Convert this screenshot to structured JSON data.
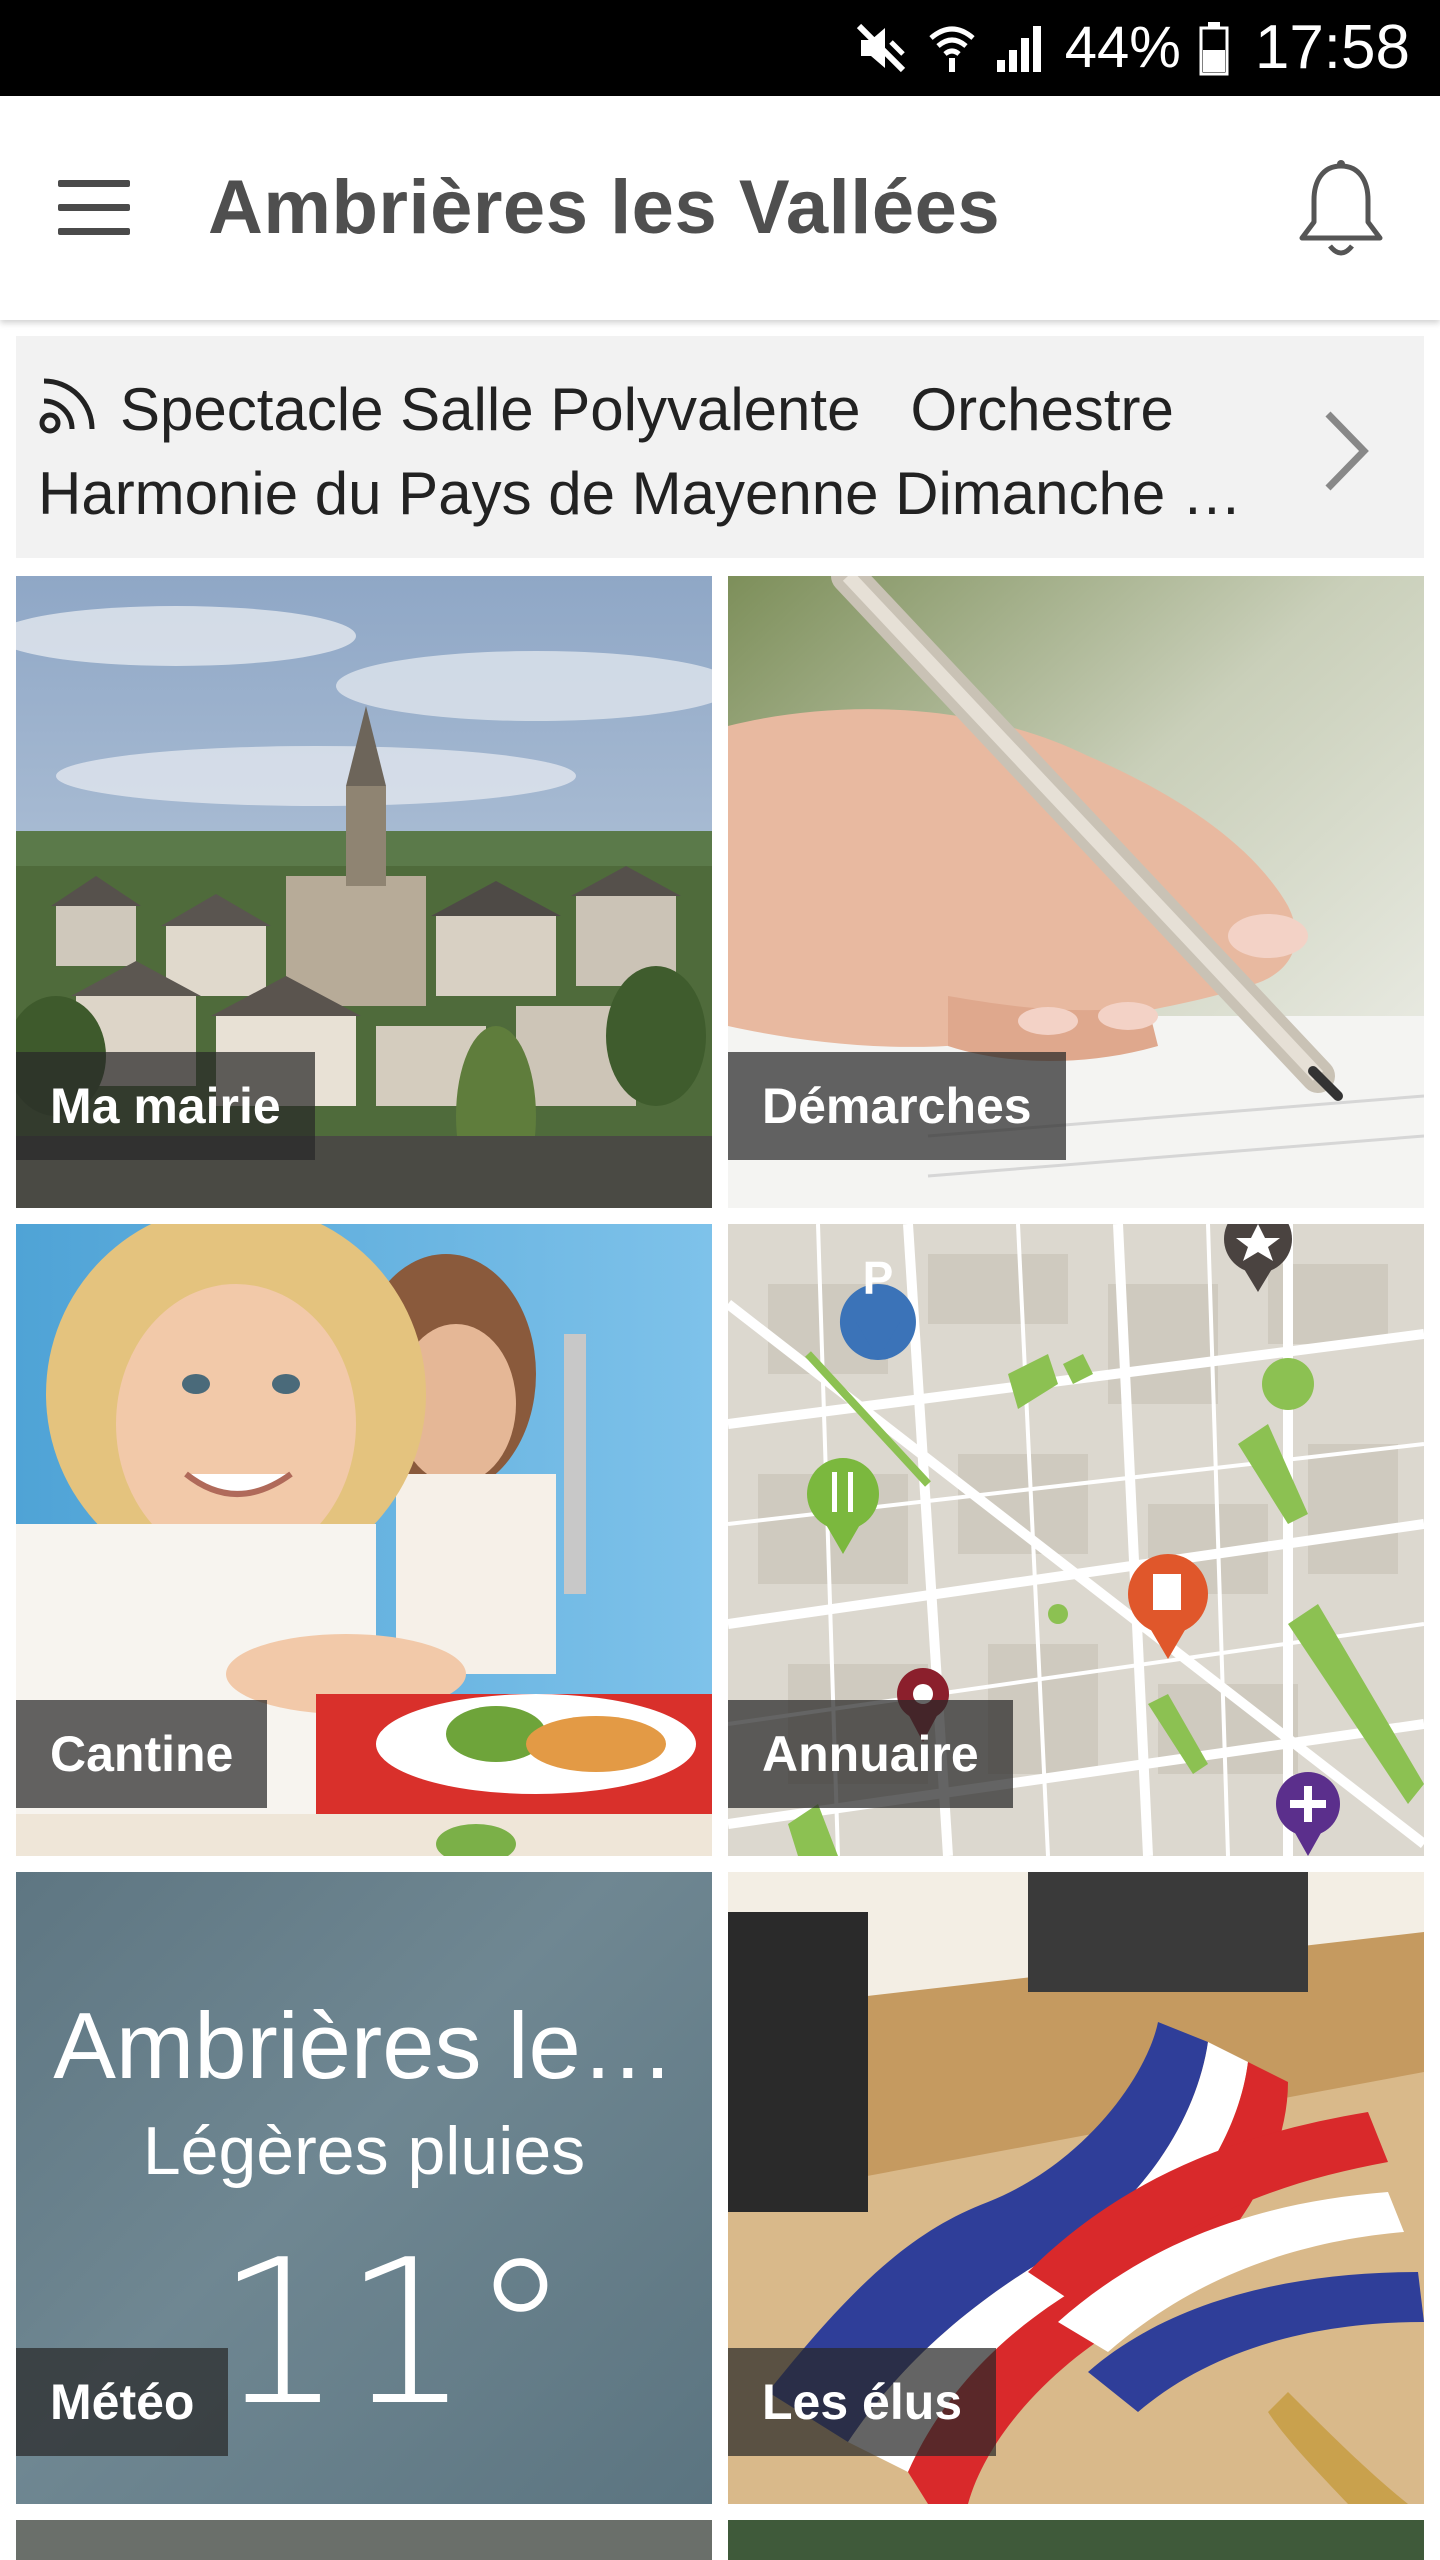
{
  "status_bar": {
    "battery": "44%",
    "time": "17:58",
    "icons": [
      "mute-icon",
      "wifi-icon",
      "signal-icon",
      "battery-icon"
    ]
  },
  "app_bar": {
    "title": "Ambrières les Vallées",
    "menu_icon": "hamburger-menu-icon",
    "notification_icon": "bell-icon"
  },
  "ticker": {
    "icon": "rss-icon",
    "line1": "Spectacle Salle Polyvalente   Orchestre",
    "line2": "Harmonie du Pays de Mayenne Dimanche …"
  },
  "tiles": [
    {
      "label": "Ma mairie",
      "image": "village-church-photo"
    },
    {
      "label": "Démarches",
      "image": "hand-writing-pen-photo"
    },
    {
      "label": "Cantine",
      "image": "child-eating-lunch-photo"
    },
    {
      "label": "Annuaire",
      "image": "city-map-with-pins"
    },
    {
      "label": "Météo",
      "city": "Ambrières le…",
      "condition": "Légères pluies",
      "temperature": "11°"
    },
    {
      "label": "Les élus",
      "image": "french-tricolor-sash-photo"
    }
  ],
  "colors": {
    "status_bar": "#000000",
    "title": "#4f4f4f",
    "ticker_bg": "#f2f2f2",
    "label_bg": "rgba(40,40,40,0.72)",
    "weather_bg": "#6a828d",
    "map_green": "#8cc152"
  }
}
